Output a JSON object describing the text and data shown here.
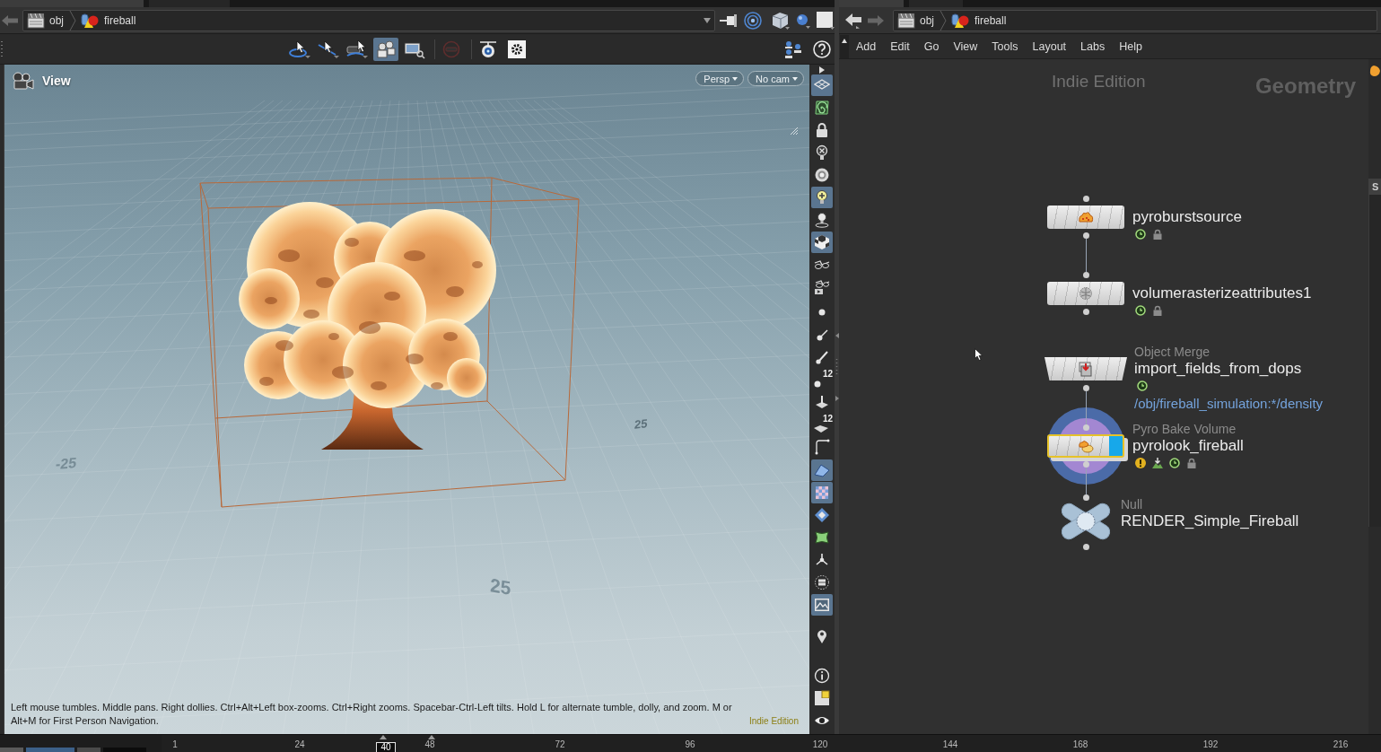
{
  "left_pane": {
    "path_bar": {
      "crumbs": [
        {
          "label": "obj"
        },
        {
          "label": "fireball"
        }
      ]
    },
    "view_tools": [
      {
        "on": false,
        "disabled": false
      },
      {
        "on": false,
        "disabled": false
      },
      {
        "on": false,
        "disabled": false
      },
      {
        "on": true,
        "disabled": false
      },
      {
        "on": false,
        "disabled": false
      },
      {
        "on": false,
        "disabled": true
      },
      {
        "on": false,
        "disabled": false
      },
      {
        "on": false,
        "disabled": false
      }
    ],
    "viewport": {
      "title": "View",
      "camera_menus": [
        {
          "label": "Persp"
        },
        {
          "label": "No cam"
        }
      ],
      "grid_labels": [
        "-25",
        "25",
        "25"
      ],
      "help_text": "Left mouse tumbles. Middle pans. Right dollies. Ctrl+Alt+Left box-zooms. Ctrl+Right zooms. Spacebar-Ctrl-Left tilts. Hold L for alternate tumble, dolly, and zoom. M or Alt+M for First Person Navigation.",
      "edition_mark": "Indie Edition"
    },
    "display_toolbar": [
      {
        "on": true
      },
      {
        "on": false
      },
      {
        "on": false
      },
      {
        "on": false
      },
      {
        "on": false
      },
      {
        "on": true
      },
      {
        "on": false
      },
      {
        "on": true
      },
      {
        "on": false
      },
      {
        "on": false
      },
      {
        "on": false
      },
      {
        "on": false
      },
      {
        "on": false
      },
      {
        "on": false,
        "label": "12"
      },
      {
        "on": false
      },
      {
        "on": false,
        "label": "12"
      },
      {
        "on": false
      },
      {
        "on": true
      },
      {
        "on": true
      },
      {
        "on": false
      },
      {
        "on": false
      },
      {
        "on": false
      },
      {
        "on": false
      },
      {
        "on": true
      },
      {
        "on": false
      },
      {
        "on": false
      },
      {
        "on": false
      },
      {
        "on": false
      }
    ]
  },
  "network_pane": {
    "path_bar": {
      "crumbs": [
        {
          "label": "obj"
        },
        {
          "label": "fireball"
        }
      ]
    },
    "menu": [
      "Add",
      "Edit",
      "Go",
      "View",
      "Tools",
      "Layout",
      "Labs",
      "Help"
    ],
    "edition_mark": "Indie Edition",
    "context": "Geometry",
    "nodes": [
      {
        "kind": "box",
        "name": "pyroburstsource",
        "has_input": true,
        "wired_below": true,
        "selected": false,
        "display": false,
        "highlighted": false,
        "flags": [
          {
            "kind": "ok"
          },
          {
            "kind": "lock"
          }
        ]
      },
      {
        "kind": "box",
        "name": "volumerasterizeattributes1",
        "has_input": true,
        "wired_below": false,
        "selected": false,
        "display": false,
        "highlighted": false,
        "flags": [
          {
            "kind": "ok"
          },
          {
            "kind": "lock"
          }
        ]
      },
      {
        "kind": "trapezoid",
        "type": "Object Merge",
        "name": "import_fields_from_dops",
        "has_input": false,
        "wired_below": true,
        "selected": false,
        "display": false,
        "highlighted": false,
        "flags": [
          {
            "kind": "ok"
          }
        ],
        "parameter": "/obj/fireball_simulation:*/density"
      },
      {
        "kind": "box",
        "type": "Pyro Bake Volume",
        "name": "pyrolook_fireball",
        "has_input": true,
        "wired_below": true,
        "selected": true,
        "display": true,
        "highlighted": true,
        "flags": [
          {
            "kind": "warning"
          },
          {
            "kind": "export"
          },
          {
            "kind": "ok"
          },
          {
            "kind": "lock"
          }
        ]
      },
      {
        "kind": "cross",
        "type": "Null",
        "name": "RENDER_Simple_Fireball",
        "has_input": true,
        "wired_below": false,
        "selected": false,
        "display": false,
        "highlighted": false
      }
    ],
    "side_tab": "S"
  },
  "timeline": {
    "ticks": [
      "1",
      "24",
      "48",
      "72",
      "96",
      "120",
      "144",
      "168",
      "192",
      "216"
    ],
    "current_frame": {
      "label": "40",
      "level": 0.184
    }
  }
}
